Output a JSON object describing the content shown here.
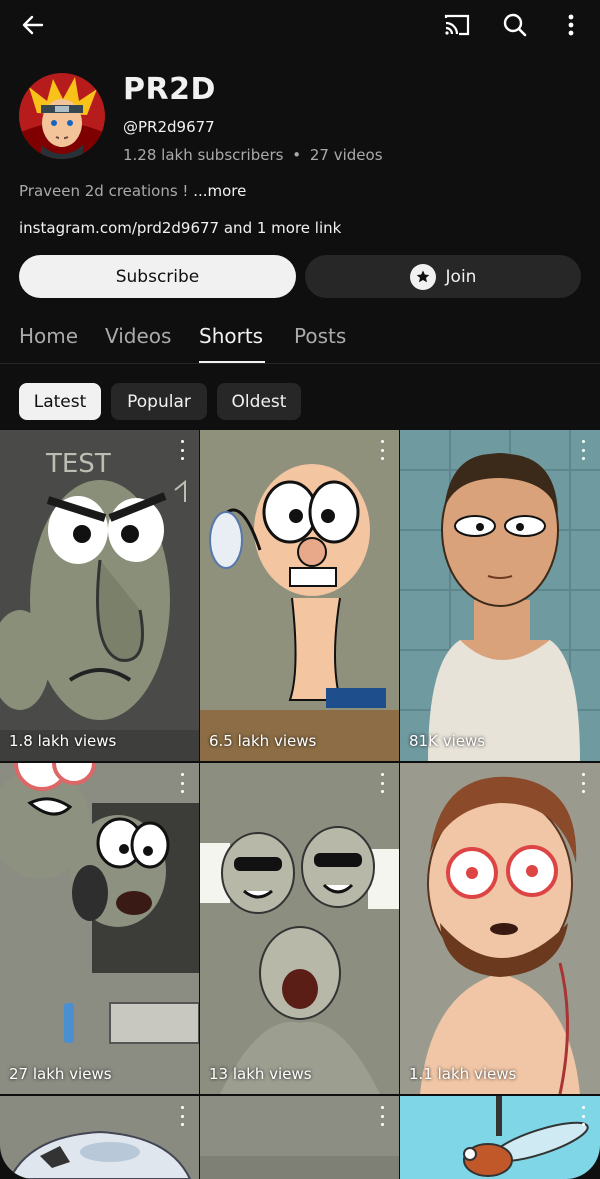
{
  "topbar": {
    "icons": [
      "back-arrow-icon",
      "cast-icon",
      "search-icon",
      "more-vert-icon"
    ]
  },
  "channel": {
    "name": "PR2D",
    "handle": "@PR2d9677",
    "subscribers": "1.28 lakh subscribers",
    "separator": "•",
    "videos": "27 videos",
    "description": "Praveen 2d creations ! ",
    "description_more": "...more",
    "links_text": "instagram.com/prd2d9677 and 1 more link"
  },
  "buttons": {
    "subscribe": "Subscribe",
    "join": "Join"
  },
  "tabs": [
    {
      "label": "Home",
      "active": false
    },
    {
      "label": "Videos",
      "active": false
    },
    {
      "label": "Shorts",
      "active": true
    },
    {
      "label": "Posts",
      "active": false
    }
  ],
  "chips": [
    {
      "label": "Latest",
      "selected": true
    },
    {
      "label": "Popular",
      "selected": false
    },
    {
      "label": "Oldest",
      "selected": false
    }
  ],
  "shorts": [
    {
      "views": "1.8 lakh views"
    },
    {
      "views": "6.5 lakh views"
    },
    {
      "views": "81K views"
    },
    {
      "views": "27 lakh views"
    },
    {
      "views": "13 lakh views"
    },
    {
      "views": "1.1 lakh views"
    },
    {
      "views": ""
    },
    {
      "views": ""
    },
    {
      "views": ""
    }
  ],
  "art_text": {
    "board_word": "TEST"
  }
}
